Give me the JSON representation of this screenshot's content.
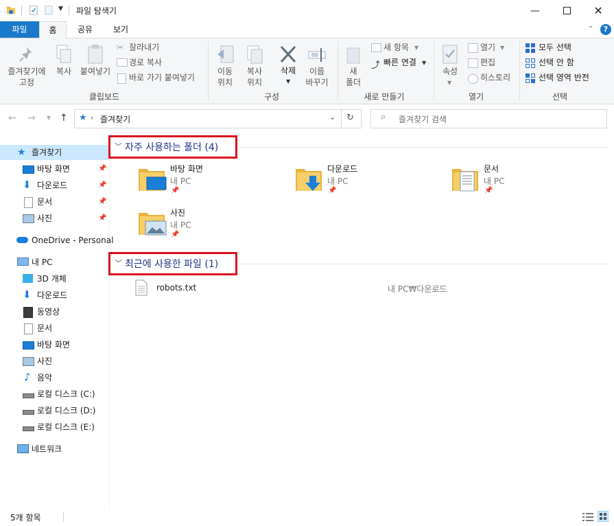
{
  "window": {
    "title": "파일 탐색기",
    "minimize_icon": "minimize-icon",
    "maximize_icon": "maximize-icon",
    "close_icon": "close-icon"
  },
  "tabs": [
    "파일",
    "홈",
    "공유",
    "보기"
  ],
  "ribbon": {
    "clipboard": {
      "pin_label": "즐겨찾기에\n고정",
      "copy_label": "복사",
      "paste_label": "붙여넣기",
      "cut_label": "잘라내기",
      "copy_path_label": "경로 복사",
      "paste_shortcut_label": "바로 가기 붙여넣기",
      "group_label": "클립보드"
    },
    "organize": {
      "move_label": "이동\n위치",
      "copyto_label": "복사\n위치",
      "delete_label": "삭제",
      "rename_label": "이름\n바꾸기",
      "group_label": "구성"
    },
    "new": {
      "new_folder_label": "새\n폴더",
      "new_item_label": "새 항목",
      "easy_access_label": "빠른 연결",
      "group_label": "새로 만들기"
    },
    "open": {
      "properties_label": "속성",
      "open_label": "열기",
      "edit_label": "편집",
      "history_label": "히스토리",
      "group_label": "열기"
    },
    "select": {
      "select_all_label": "모두 선택",
      "select_none_label": "선택 안 함",
      "invert_label": "선택 영역 반전",
      "group_label": "선택"
    }
  },
  "address": {
    "path": "즐겨찾기",
    "search_placeholder": "즐겨찾기 검색"
  },
  "nav": {
    "quick_access": "즐겨찾기",
    "qa_items": [
      "바탕 화면",
      "다운로드",
      "문서",
      "사진"
    ],
    "onedrive": "OneDrive - Personal",
    "this_pc": "내 PC",
    "pc_items": [
      "3D 개체",
      "다운로드",
      "동영상",
      "문서",
      "바탕 화면",
      "사진",
      "음악",
      "로컬 디스크 (C:)",
      "로컬 디스크 (D:)",
      "로컬 디스크 (E:)"
    ],
    "network": "네트워크"
  },
  "frequent": {
    "header": "자주 사용하는 폴더 (4)",
    "folders": [
      {
        "name": "바탕 화면",
        "location": "내 PC"
      },
      {
        "name": "다운로드",
        "location": "내 PC"
      },
      {
        "name": "문서",
        "location": "내 PC"
      },
      {
        "name": "사진",
        "location": "내 PC"
      }
    ]
  },
  "recent": {
    "header": "최근에 사용한 파일 (1)",
    "files": [
      {
        "name": "robots.txt",
        "path": "내 PC₩다운로드"
      }
    ]
  },
  "status": {
    "item_count": "5개 항목"
  },
  "colors": {
    "accent": "#1979ca",
    "selection": "#cce8ff",
    "header_text": "#1e3287",
    "highlight_box": "#d9121b",
    "folder": "#f0c65a"
  }
}
